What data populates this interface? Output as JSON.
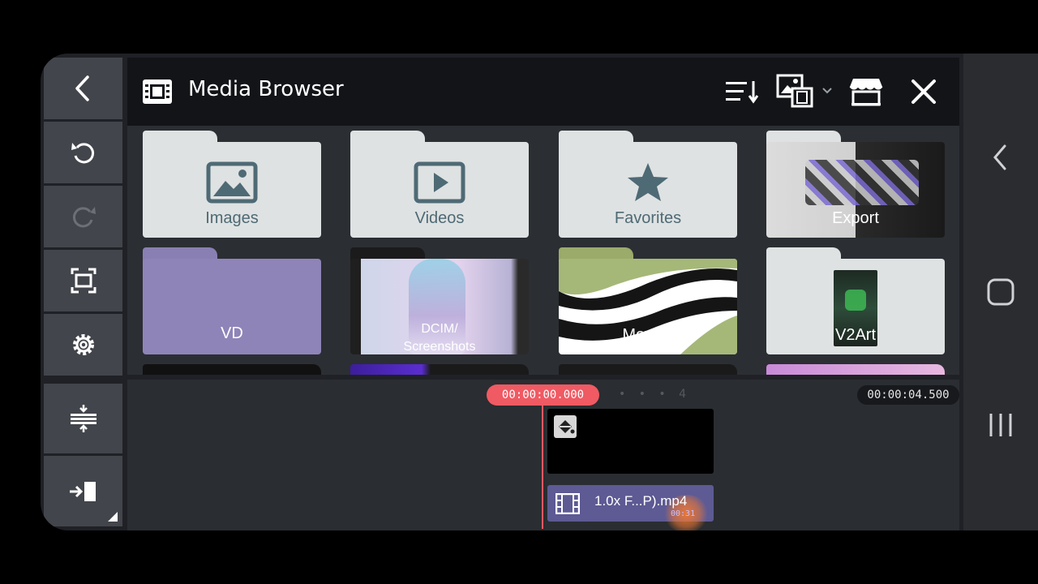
{
  "app": {
    "title": "Media Browser"
  },
  "header_actions": [
    "sort-icon",
    "media-type-icon",
    "store-icon",
    "close-icon"
  ],
  "left_toolbar": [
    "back-icon",
    "undo-icon",
    "redo-icon",
    "fullscreen-icon",
    "settings-icon",
    "track-adjust-icon",
    "export-icon"
  ],
  "folders": [
    {
      "label": "Images",
      "style": "light",
      "icon": "image-icon"
    },
    {
      "label": "Videos",
      "style": "light",
      "icon": "play-icon"
    },
    {
      "label": "Favorites",
      "style": "light",
      "icon": "star-icon"
    },
    {
      "label": "Export",
      "style": "thumbnail"
    },
    {
      "label": "VD",
      "style": "thumbnail"
    },
    {
      "label": "DCIM/",
      "sublabel": "Screenshots",
      "style": "thumbnail"
    },
    {
      "label": "Movies",
      "style": "thumbnail"
    },
    {
      "label": "V2Art",
      "style": "thumbnail"
    }
  ],
  "timeline": {
    "current_time": "00:00:00.000",
    "end_time": "00:00:04.500",
    "ruler_mark": "4",
    "clip_label": "1.0x F...P).mp4",
    "clip_duration": "00:31"
  },
  "colors": {
    "accent": "#f05a63",
    "folder_light": "#dfe2e2",
    "folder_label": "#4e6a75",
    "clip_video": "#5d5a94"
  }
}
